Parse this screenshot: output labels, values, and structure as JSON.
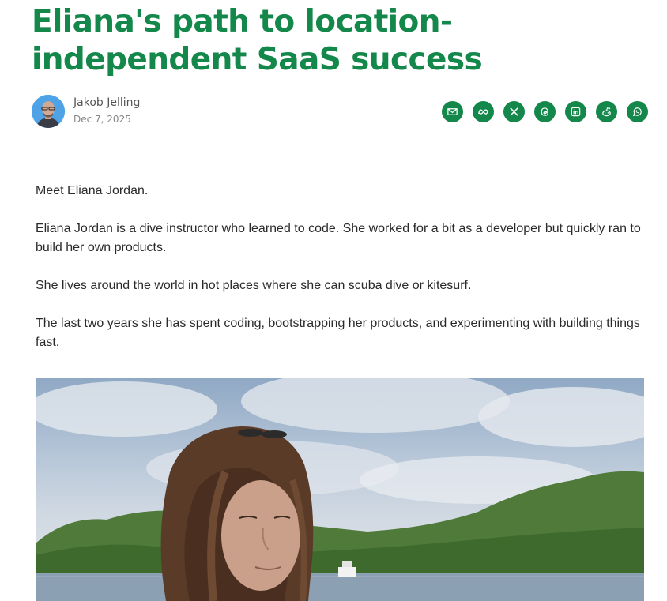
{
  "article": {
    "title": "Eliana's path to location-independent SaaS success",
    "author": {
      "name": "Jakob Jelling",
      "date": "Dec 7, 2025"
    },
    "share_icons": [
      "email-icon",
      "meta-icon",
      "x-icon",
      "threads-icon",
      "linkedin-icon",
      "reddit-icon",
      "whatsapp-icon"
    ],
    "paragraphs": [
      "Meet Eliana Jordan.",
      "Eliana Jordan is a dive instructor who learned to code. She worked for a bit as a developer but quickly ran to build her own products.",
      "She lives around the world in hot places where she can scuba dive or kitesurf.",
      "The last two years she has spent coding, bootstrapping her products, and experimenting with building things fast."
    ]
  },
  "colors": {
    "brand_green": "#14874a",
    "text": "#2a2a2a",
    "meta": "#888888"
  }
}
